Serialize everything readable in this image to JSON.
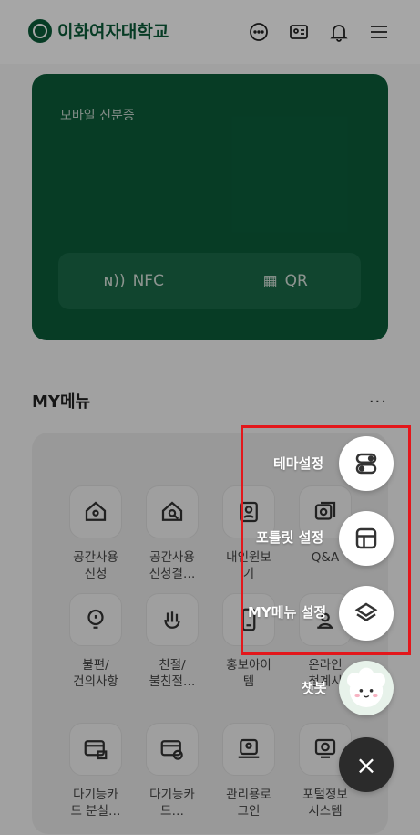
{
  "header": {
    "school_name": "이화여자대학교",
    "icons": [
      "chat-icon",
      "id-card-icon",
      "bell-icon",
      "hamburger-icon"
    ]
  },
  "id_card": {
    "title": "모바일 신분증",
    "nfc_label": "NFC",
    "qr_label": "QR",
    "color": "#0b5d3a"
  },
  "my_menu": {
    "title": "MY메뉴",
    "more_label": "···",
    "items": [
      {
        "label": "공간사용\n신청",
        "icon": "space-request-icon"
      },
      {
        "label": "공간사용\n신청결…",
        "icon": "space-search-icon"
      },
      {
        "label": "내인원보\n기",
        "icon": "person-icon"
      },
      {
        "label": "Q&A",
        "icon": "qa-icon"
      },
      {
        "label": "불편/\n건의사항",
        "icon": "lightbulb-icon"
      },
      {
        "label": "친절/\n불친절…",
        "icon": "hand-icon"
      },
      {
        "label": "홍보아이\n템",
        "icon": "phone-icon"
      },
      {
        "label": "온라인\n청계시",
        "icon": "online-icon"
      },
      {
        "label": "다기능카\n드 분실…",
        "icon": "card-lock-icon"
      },
      {
        "label": "다기능카\n드…",
        "icon": "card-check-icon"
      },
      {
        "label": "관리용로\n그인",
        "icon": "admin-login-icon"
      },
      {
        "label": "포털정보\n시스템",
        "icon": "portal-icon"
      }
    ]
  },
  "fab_menu": {
    "theme": "테마설정",
    "portlet": "포틀릿 설정",
    "mymenu": "MY메뉴 설정",
    "chatbot": "챗봇",
    "close": "×"
  },
  "colors": {
    "highlight": "#e3171b",
    "brand": "#0b5d3a"
  }
}
